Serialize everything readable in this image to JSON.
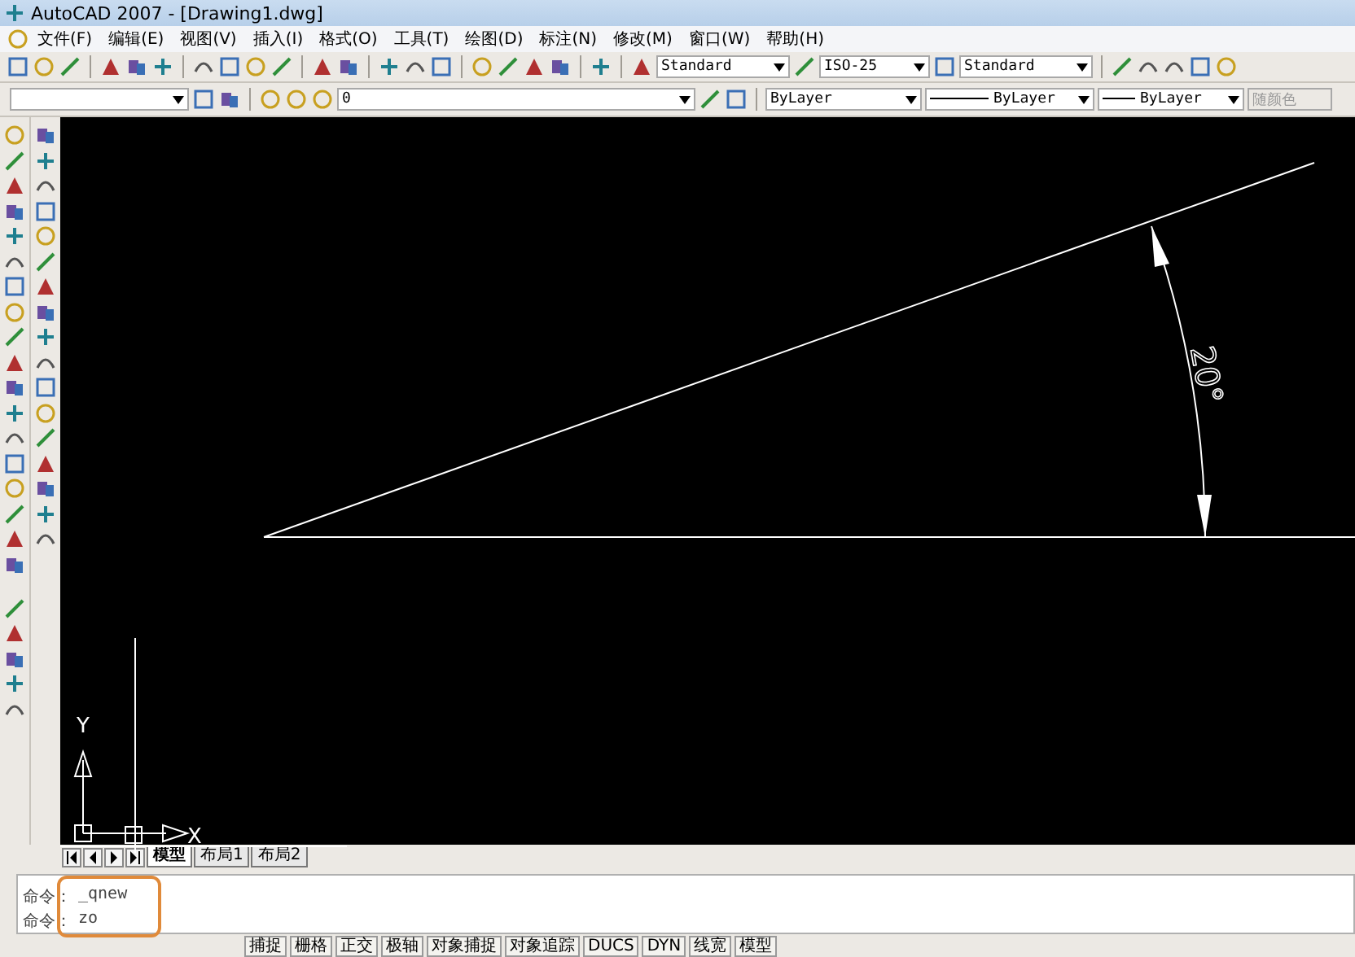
{
  "window": {
    "title": "AutoCAD 2007 - [Drawing1.dwg]"
  },
  "menu": [
    "文件(F)",
    "编辑(E)",
    "视图(V)",
    "插入(I)",
    "格式(O)",
    "工具(T)",
    "绘图(D)",
    "标注(N)",
    "修改(M)",
    "窗口(W)",
    "帮助(H)"
  ],
  "styles_toolbar": {
    "text_style": "Standard",
    "dim_style": "ISO-25",
    "table_style": "Standard"
  },
  "properties_toolbar": {
    "layer": "0",
    "color_setting": "ByLayer",
    "linetype": "ByLayer",
    "lineweight": "ByLayer",
    "plot_style": {
      "label": "随颜色",
      "disabled": true
    }
  },
  "drawing": {
    "dimension_text": "20°",
    "ucs_x": "X",
    "ucs_y": "Y"
  },
  "layout_tabs": [
    {
      "label": "模型",
      "selected": true
    },
    {
      "label": "布局1",
      "selected": false
    },
    {
      "label": "布局2",
      "selected": false
    }
  ],
  "command_lines": [
    {
      "prompt": "命令：",
      "text": "_qnew"
    },
    {
      "prompt": "命令：",
      "text": "zo"
    }
  ],
  "status_buttons": [
    "捕捉",
    "栅格",
    "正交",
    "极轴",
    "对象捕捉",
    "对象追踪",
    "DUCS",
    "DYN",
    "线宽",
    "模型"
  ]
}
